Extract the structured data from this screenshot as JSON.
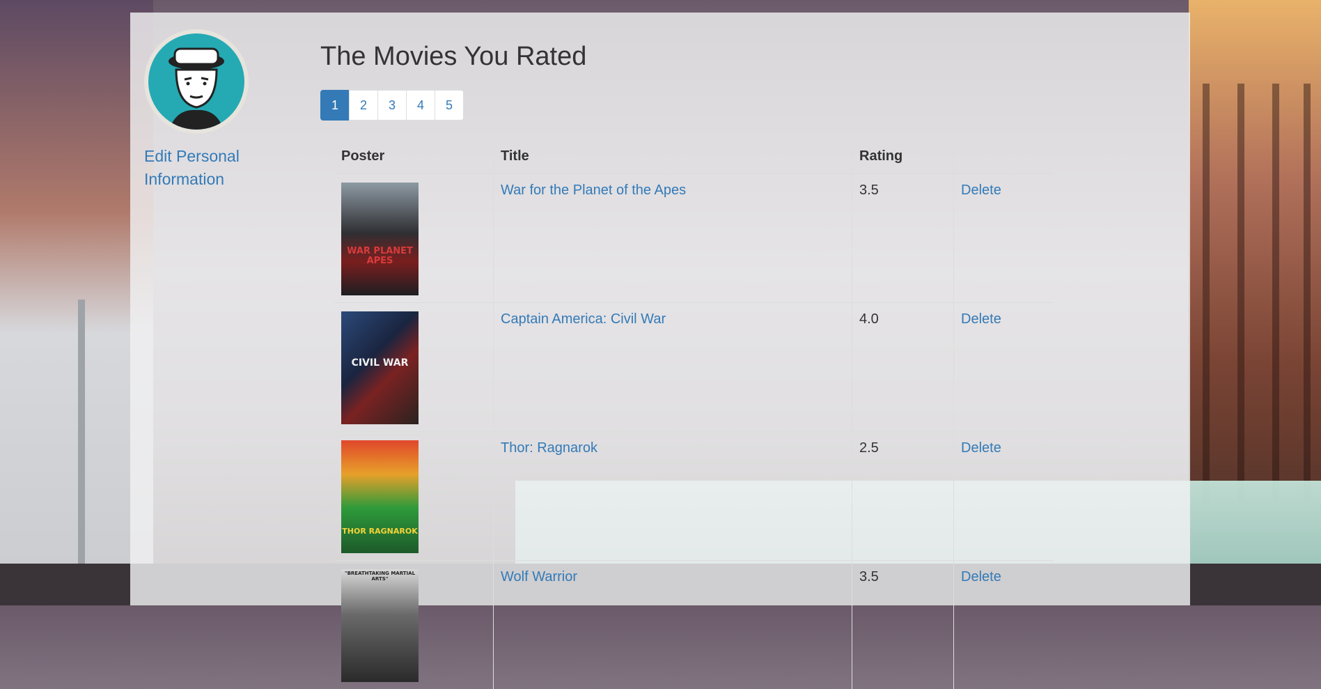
{
  "sidebar": {
    "avatar_icon": "cartoon-avatar-icon",
    "edit_label": "Edit Personal Information"
  },
  "main": {
    "title": "The Movies You Rated",
    "pages": [
      "1",
      "2",
      "3",
      "4",
      "5"
    ],
    "active_page": "1",
    "table": {
      "headers": [
        "Poster",
        "Title",
        "Rating",
        ""
      ],
      "rows": [
        {
          "poster_text": "WAR PLANET APES",
          "title": "War for the Planet of the Apes",
          "rating": "3.5",
          "action": "Delete"
        },
        {
          "poster_text": "CIVIL WAR",
          "title": "Captain America: Civil War",
          "rating": "4.0",
          "action": "Delete"
        },
        {
          "poster_text": "THOR RAGNAROK",
          "title": "Thor: Ragnarok",
          "rating": "2.5",
          "action": "Delete"
        },
        {
          "poster_text": "\"BREATHTAKING MARTIAL ARTS\"",
          "title": "Wolf Warrior",
          "rating": "3.5",
          "action": "Delete"
        }
      ]
    }
  },
  "colors": {
    "link": "#337ab7",
    "active_page": "#337ab7",
    "avatar_bg": "#25aab4"
  }
}
